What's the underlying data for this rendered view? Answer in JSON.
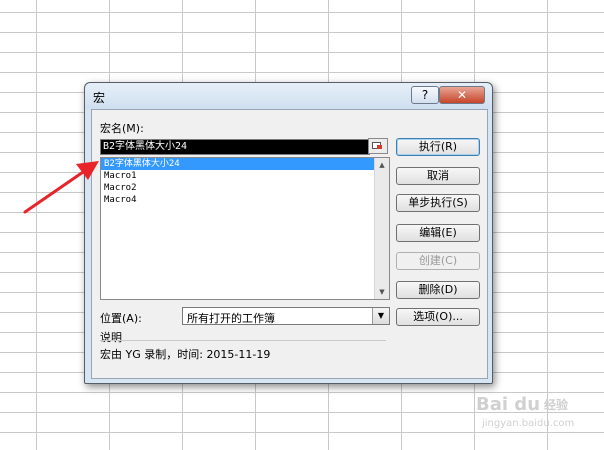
{
  "dialog": {
    "title": "宏",
    "help_label": "?",
    "close_label": "✕",
    "macro_name_label": "宏名(M):",
    "macro_name_value": "B2字体黑体大小24",
    "macros": [
      "B2字体黑体大小24",
      "Macro1",
      "Macro2",
      "Macro4"
    ],
    "selected_index": 0,
    "location_label": "位置(A):",
    "location_value": "所有打开的工作簿",
    "description_label": "说明",
    "description_text": "宏由 YG 录制，时间: 2015-11-19",
    "buttons": {
      "run": "执行(R)",
      "cancel": "取消",
      "step_into": "单步执行(S)",
      "edit": "编辑(E)",
      "create": "创建(C)",
      "delete": "删除(D)",
      "options": "选项(O)..."
    }
  },
  "watermark": {
    "brand": "Bai du",
    "brand_suffix": "经验",
    "url": "jingyan.baidu.com"
  },
  "colors": {
    "annotation_arrow": "#e8242a",
    "selection": "#3399ff"
  }
}
